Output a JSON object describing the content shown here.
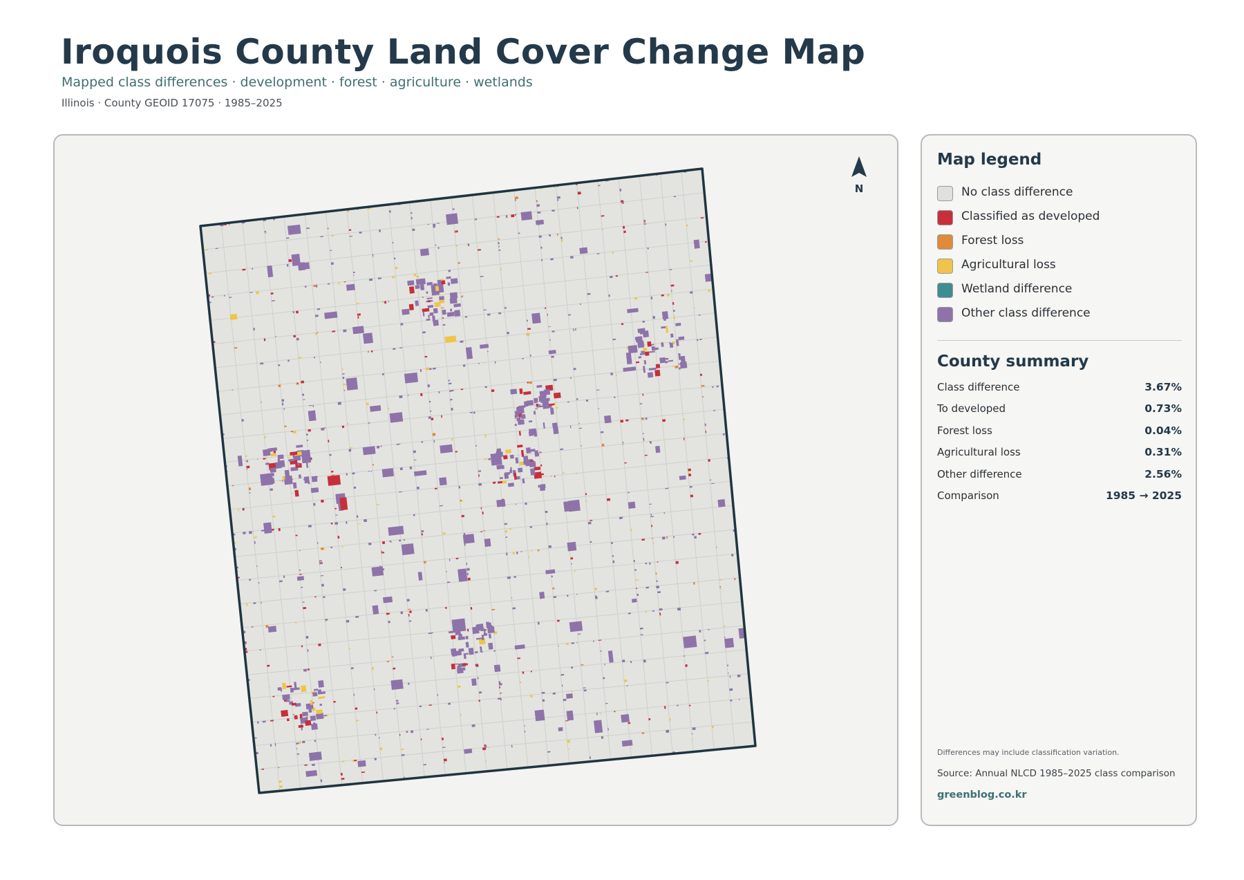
{
  "header": {
    "title": "Iroquois County Land Cover Change Map",
    "subtitle": "Mapped class differences · development · forest · agriculture · wetlands",
    "meta": "Illinois · County GEOID 17075 · 1985–2025"
  },
  "map": {
    "north_label": "N",
    "colors": {
      "county_fill": "#e3e4e0",
      "county_outline": "#1f3540",
      "grid_lines": "#cdd0cc",
      "developed": "#c62f3b",
      "forest_loss": "#e08a3c",
      "agricultural_loss": "#eec54a",
      "wetland": "#3f8c93",
      "other": "#8e73a9"
    }
  },
  "legend": {
    "title": "Map legend",
    "items": [
      {
        "label": "No class difference",
        "color": "#e0e0de"
      },
      {
        "label": "Classified as developed",
        "color": "#c62f3b"
      },
      {
        "label": "Forest loss",
        "color": "#e08a3c"
      },
      {
        "label": "Agricultural loss",
        "color": "#eec54a"
      },
      {
        "label": "Wetland difference",
        "color": "#3f8c93"
      },
      {
        "label": "Other class difference",
        "color": "#8e73a9"
      }
    ]
  },
  "summary": {
    "title": "County summary",
    "rows": [
      {
        "label": "Class difference",
        "value": "3.67%"
      },
      {
        "label": "To developed",
        "value": "0.73%"
      },
      {
        "label": "Forest loss",
        "value": "0.04%"
      },
      {
        "label": "Agricultural loss",
        "value": "0.31%"
      },
      {
        "label": "Other difference",
        "value": "2.56%"
      },
      {
        "label": "Comparison",
        "value": "1985 → 2025"
      }
    ]
  },
  "footer": {
    "note": "Differences may include classification variation.",
    "source": "Source: Annual NLCD 1985–2025 class comparison",
    "site": "greenblog.co.kr"
  }
}
